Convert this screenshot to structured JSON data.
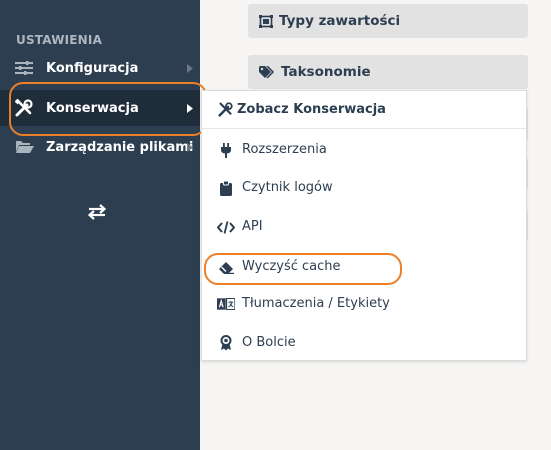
{
  "sidebar": {
    "section_heading": "USTAWIENIA",
    "items": [
      {
        "label": "Konfiguracja",
        "icon": "sliders-icon"
      },
      {
        "label": "Konserwacja",
        "icon": "tools-icon"
      },
      {
        "label": "Zarządzanie plikami",
        "icon": "folder-open-icon"
      }
    ],
    "toggle_icon": "exchange-arrows-icon"
  },
  "content": {
    "bars": [
      {
        "label": "Typy zawartości",
        "icon": "object-group-icon"
      },
      {
        "label": "Taksonomie",
        "icon": "tags-icon"
      }
    ]
  },
  "dropdown": {
    "header": "Zobacz Konserwacja",
    "items": [
      {
        "label": "Rozszerzenia",
        "icon": "plug-icon"
      },
      {
        "label": "Czytnik logów",
        "icon": "clipboard-icon"
      },
      {
        "label": "API",
        "icon": "code-icon"
      },
      {
        "label": "Wyczyść cache",
        "icon": "eraser-icon"
      },
      {
        "label": "Tłumaczenia / Etykiety",
        "icon": "language-icon"
      },
      {
        "label": "O Bolcie",
        "icon": "award-icon"
      }
    ]
  },
  "colors": {
    "sidebar_bg": "#2c3e50",
    "active_bg": "#1f2d3b",
    "highlight": "#ec7f2a",
    "text_dark": "#2c3e50"
  }
}
